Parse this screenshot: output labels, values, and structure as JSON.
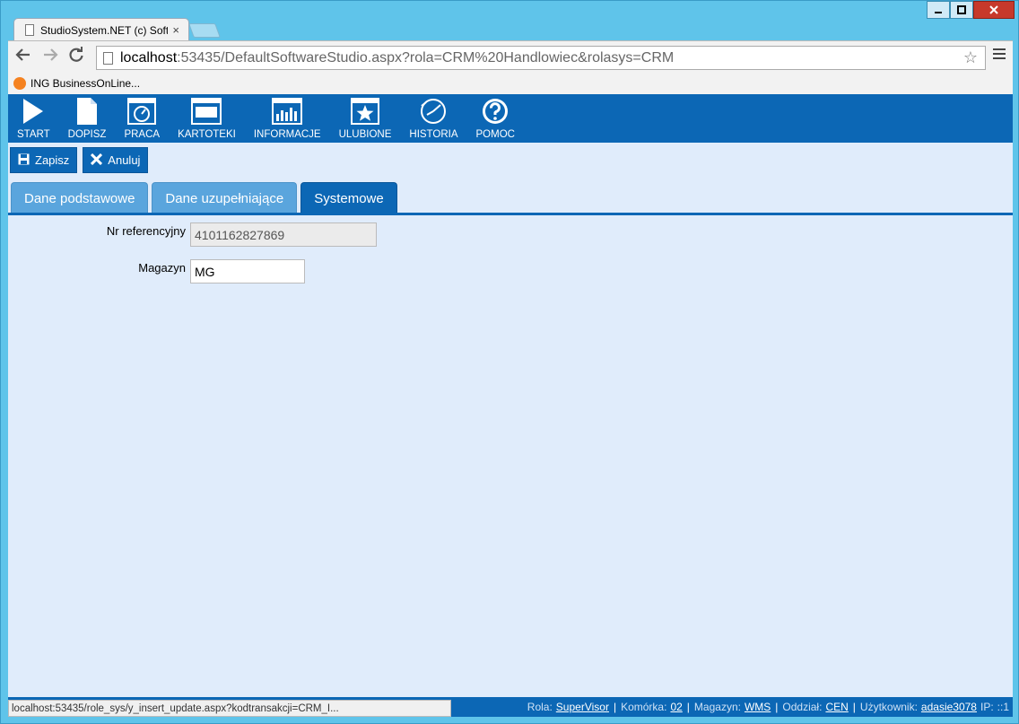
{
  "browser": {
    "tab_title": "StudioSystem.NET (c) Soft",
    "tab_close": "×",
    "url_host": "localhost",
    "url_rest": ":53435/DefaultSoftwareStudio.aspx?rola=CRM%20Handlowiec&rolasys=CRM",
    "bookmark": "ING BusinessOnLine...",
    "bookmark_icon": "ING",
    "status_url": "localhost:53435/role_sys/y_insert_update.aspx?kodtransakcji=CRM_I..."
  },
  "nav": [
    {
      "label": "START",
      "icon": "play-icon"
    },
    {
      "label": "DOPISZ",
      "icon": "document-icon"
    },
    {
      "label": "PRACA",
      "icon": "gauge-icon"
    },
    {
      "label": "KARTOTEKI",
      "icon": "monitor-icon"
    },
    {
      "label": "INFORMACJE",
      "icon": "bar-chart-icon"
    },
    {
      "label": "ULUBIONE",
      "icon": "star-icon"
    },
    {
      "label": "HISTORIA",
      "icon": "history-icon"
    },
    {
      "label": "POMOC",
      "icon": "help-icon"
    }
  ],
  "actions": {
    "save_label": "Zapisz",
    "cancel_label": "Anuluj"
  },
  "tabs": [
    {
      "label": "Dane podstawowe",
      "active": false
    },
    {
      "label": "Dane uzupełniające",
      "active": false
    },
    {
      "label": "Systemowe",
      "active": true
    }
  ],
  "form": {
    "ref_label": "Nr referencyjny",
    "ref_value": "4101162827869",
    "warehouse_label": "Magazyn",
    "warehouse_value": "MG"
  },
  "status": {
    "role_label": "Rola:",
    "role_value": "SuperVisor",
    "cell_label": "Komórka:",
    "cell_value": "02",
    "warehouse_label": "Magazyn:",
    "warehouse_value": "WMS",
    "branch_label": "Oddział:",
    "branch_value": "CEN",
    "user_label": "Użytkownik:",
    "user_value": "adasie3078",
    "ip_label": "IP:",
    "ip_value": "::1"
  },
  "colors": {
    "primary": "#0c67b5",
    "tab_inactive": "#5aa5dd",
    "content_bg": "#e0ecfb"
  }
}
